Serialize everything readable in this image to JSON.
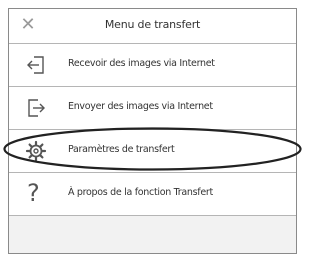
{
  "header": {
    "close_icon": "close-icon",
    "title": "Menu de transfert"
  },
  "menu": {
    "items": [
      {
        "label": "Recevoir des images via Internet",
        "icon": "receive-icon"
      },
      {
        "label": "Envoyer des images via Internet",
        "icon": "send-icon"
      },
      {
        "label": "Paramètres de transfert",
        "icon": "gear-icon"
      },
      {
        "label": "À propos de la fonction Transfert",
        "icon": "question-icon"
      }
    ]
  },
  "colors": {
    "text": "#333333",
    "icon": "#555555",
    "border": "#b5b5b5",
    "highlight_outline": "#222222"
  }
}
